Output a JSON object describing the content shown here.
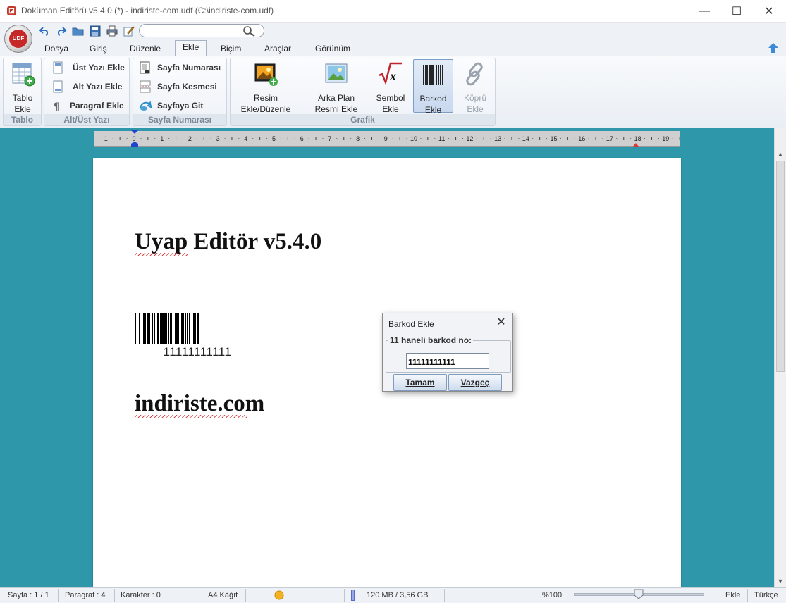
{
  "window": {
    "title": "Doküman Editörü v5.4.0 (*) - indiriste-com.udf (C:\\indiriste-com.udf)",
    "minimize_glyph": "—",
    "maximize_glyph": "☐",
    "close_glyph": "✕"
  },
  "logo": {
    "text": "UDF"
  },
  "menu": {
    "tabs": [
      "Dosya",
      "Giriş",
      "Düzenle",
      "Ekle",
      "Biçim",
      "Araçlar",
      "Görünüm"
    ],
    "active": "Ekle"
  },
  "ribbon": {
    "tablo": {
      "button": [
        "Tablo",
        "Ekle"
      ],
      "caption": "Tablo"
    },
    "altust": {
      "items": [
        "Üst Yazı Ekle",
        "Alt Yazı Ekle",
        "Paragraf Ekle"
      ],
      "caption": "Alt/Üst Yazı"
    },
    "sayfa": {
      "items": [
        "Sayfa Numarası",
        "Sayfa Kesmesi",
        "Sayfaya Git"
      ],
      "caption": "Sayfa Numarası"
    },
    "grafik": {
      "buttons": [
        [
          "Resim",
          "Ekle/Düzenle"
        ],
        [
          "Arka Plan",
          "Resmi  Ekle"
        ],
        [
          "Sembol",
          "Ekle"
        ],
        [
          "Barkod",
          "Ekle"
        ],
        [
          "Köprü",
          "Ekle"
        ]
      ],
      "selected": "Barkod",
      "disabled": "Köprü",
      "caption": "Grafik"
    }
  },
  "ruler": {
    "labels": [
      "1",
      "0",
      "1",
      "2",
      "3",
      "4",
      "5",
      "6",
      "7",
      "8",
      "9",
      "10",
      "11",
      "12",
      "13",
      "14",
      "15",
      "16",
      "17",
      "18",
      "19"
    ]
  },
  "document": {
    "heading1": "Uyap Editör v5.4.0",
    "barcode_number": "11111111111",
    "heading2": "indiriste.com"
  },
  "dialog": {
    "title": "Barkod Ekle",
    "close": "✕",
    "legend": "11 haneli barkod no:",
    "input_value": "11111111111",
    "ok": "Tamam",
    "cancel": "Vazgeç"
  },
  "status": {
    "page": "Sayfa : 1 / 1",
    "paragraph": "Paragraf : 4",
    "characters": "Karakter : 0",
    "paper": "A4 Kâğıt",
    "memory": "120 MB / 3,56 GB",
    "zoom": "%100",
    "mode": "Ekle",
    "language": "Türkçe"
  },
  "colors": {
    "workspace": "#2e97aa",
    "accent_red": "#c62828",
    "spell_underline": "#d94343"
  }
}
